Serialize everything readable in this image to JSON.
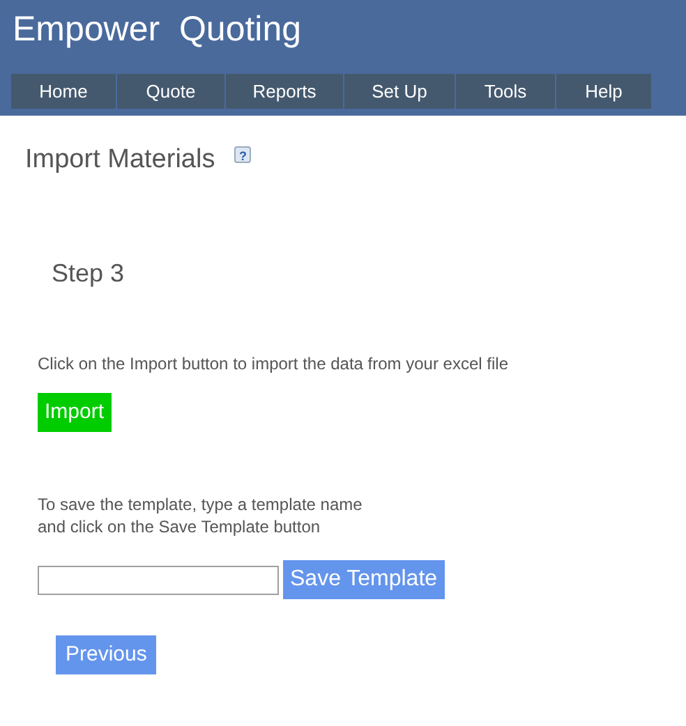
{
  "app_title": "Empower  Quoting",
  "nav": [
    {
      "label": "Home"
    },
    {
      "label": "Quote"
    },
    {
      "label": "Reports"
    },
    {
      "label": "Set Up"
    },
    {
      "label": "Tools"
    },
    {
      "label": "Help"
    }
  ],
  "page_title": "Import Materials",
  "help_icon_text": "?",
  "step": "Step 3",
  "import_instruction": "Click on the Import button to import the data from your excel file",
  "import_button": "Import",
  "save_instruction_lines": [
    "To save the template, type a template name",
    "and click on the Save Template button"
  ],
  "save_button": "Save Template",
  "previous_button": "Previous"
}
